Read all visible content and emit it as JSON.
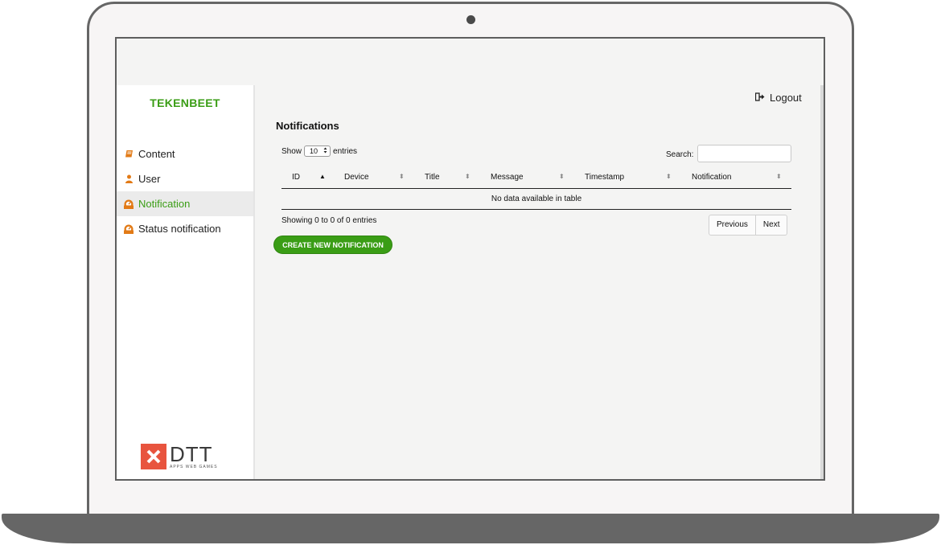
{
  "sidebar": {
    "brand": "TEKENBEET",
    "items": [
      {
        "label": "Content",
        "icon": "book-icon",
        "active": false
      },
      {
        "label": "User",
        "icon": "user-icon",
        "active": false
      },
      {
        "label": "Notification",
        "icon": "dashboard-icon",
        "active": true
      },
      {
        "label": "Status notification",
        "icon": "dashboard-icon",
        "active": false
      }
    ],
    "logo": {
      "name": "DTT",
      "tagline": "APPS WEB GAMES"
    }
  },
  "header": {
    "logout_label": "Logout"
  },
  "main": {
    "title": "Notifications",
    "show_label": "Show",
    "entries_value": "10",
    "entries_label": "entries",
    "search_label": "Search:",
    "search_value": "",
    "columns": [
      "ID",
      "Device",
      "Title",
      "Message",
      "Timestamp",
      "Notification"
    ],
    "empty_message": "No data available in table",
    "info": "Showing 0 to 0 of 0 entries",
    "pagination": {
      "previous": "Previous",
      "next": "Next"
    },
    "create_button": "CREATE NEW NOTIFICATION"
  },
  "colors": {
    "accent": "#3a9d15",
    "icon_orange": "#e27a16",
    "logo_red": "#e8543e"
  }
}
